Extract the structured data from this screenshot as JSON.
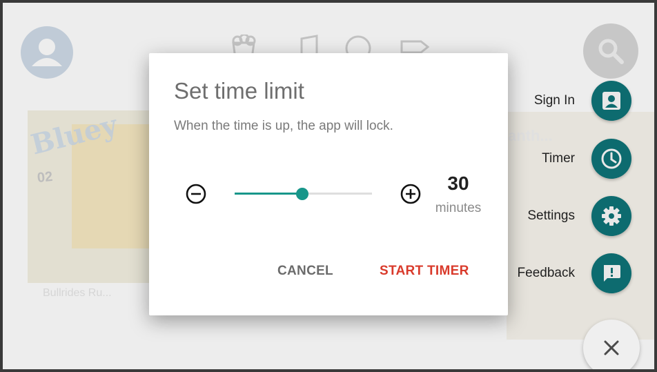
{
  "dialog": {
    "title": "Set time limit",
    "subtitle": "When the time is up, the app will lock.",
    "value": "30",
    "unit": "minutes",
    "slider_level": 0.49,
    "cancel_label": "CANCEL",
    "start_label": "START TIMER",
    "accent_color": "#17968a",
    "start_color": "#d93a2b"
  },
  "fab_menu": {
    "items": [
      {
        "label": "Sign In",
        "icon": "account-box-icon"
      },
      {
        "label": "Timer",
        "icon": "clock-icon"
      },
      {
        "label": "Settings",
        "icon": "gear-icon"
      },
      {
        "label": "Feedback",
        "icon": "feedback-icon"
      }
    ],
    "color": "#0d6b6f",
    "close_icon": "close-icon"
  },
  "background": {
    "card_title": "Bluey",
    "card_badge": "02",
    "card2_text": "anth...",
    "video_text": "Bullrides Ru..."
  }
}
